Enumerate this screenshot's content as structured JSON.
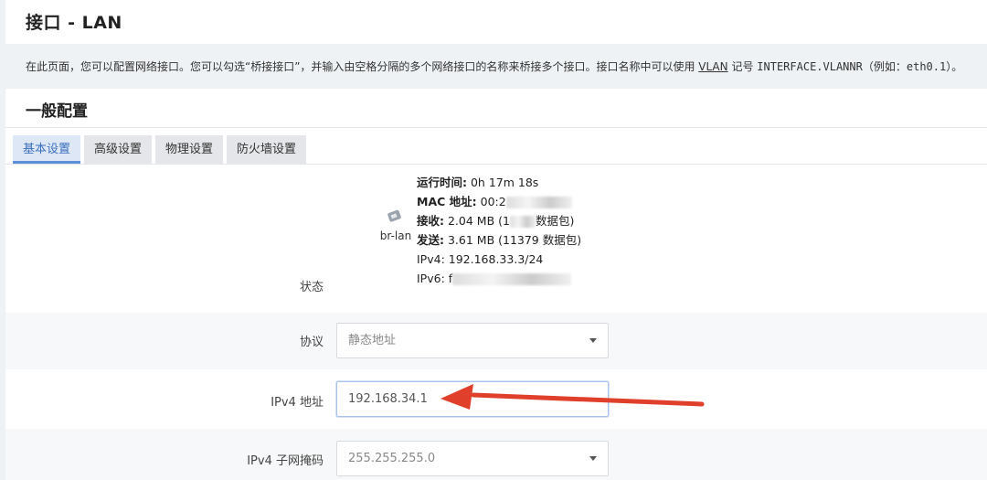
{
  "header": {
    "title": "接口 - LAN"
  },
  "description": {
    "part1": "在此页面，您可以配置网络接口。您可以勾选“桥接接口”，并输入由空格分隔的多个网络接口的名称来桥接多个接口。接口名称中可以使用 ",
    "vlan": "VLAN",
    "part2": " 记号 ",
    "mono1": "INTERFACE.VLANNR",
    "part3": "（例如：",
    "mono2": "eth0.1",
    "part4": "）。"
  },
  "section": {
    "title": "一般配置"
  },
  "tabs": [
    {
      "label": "基本设置",
      "active": true
    },
    {
      "label": "高级设置"
    },
    {
      "label": "物理设置"
    },
    {
      "label": "防火墙设置"
    }
  ],
  "status": {
    "label": "状态",
    "device": "br-lan",
    "uptime_label": "运行时间:",
    "uptime_value": " 0h 17m 18s",
    "mac_label": "MAC 地址:",
    "mac_value": " 00:2",
    "rx_label": "接收:",
    "rx_value": " 2.04 MB (1",
    "rx_tail": "数据包)",
    "tx_label": "发送:",
    "tx_value": " 3.61 MB (11379 数据包)",
    "ipv4_label": "IPv4:",
    "ipv4_value": " 192.168.33.3/24",
    "ipv6_label": "IPv6:",
    "ipv6_value": " f"
  },
  "protocol": {
    "label": "协议",
    "value": "静态地址"
  },
  "ipv4_address": {
    "label": "IPv4 地址",
    "value": "192.168.34.1"
  },
  "ipv4_netmask": {
    "label": "IPv4 子网掩码",
    "value": "255.255.255.0"
  },
  "colors": {
    "accent": "#5b8fd6",
    "arrow": "#e0402b"
  },
  "icons": {
    "device": "network-port-icon",
    "dropdown": "chevron-down-icon",
    "annotation": "red-arrow"
  }
}
